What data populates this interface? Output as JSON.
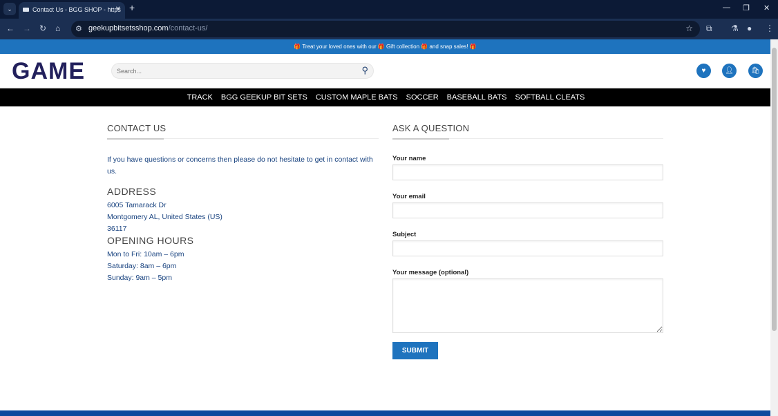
{
  "browser": {
    "tab_title": "Contact Us - BGG SHOP - https",
    "url_domain": "geekupbitsetsshop.com",
    "url_path": "/contact-us/"
  },
  "banner": {
    "text": "🎁 Treat your loved ones with our 🎁 Gift collection 🎁 and snap sales! 🎁"
  },
  "header": {
    "logo": "GAME",
    "search_placeholder": "Search..."
  },
  "nav": [
    "TRACK",
    "BGG GEEKUP BIT SETS",
    "CUSTOM MAPLE BATS",
    "SOCCER",
    "BASEBALL BATS",
    "SOFTBALL CLEATS"
  ],
  "contact": {
    "title": "CONTACT US",
    "intro": "If you have questions or concerns then please do not hesitate to get in contact with us.",
    "address_title": "ADDRESS",
    "address": [
      "6005 Tamarack Dr",
      "Montgomery AL, United States (US)",
      "36117"
    ],
    "hours_title": "OPENING HOURS",
    "hours": [
      "Mon to Fri: 10am – 6pm",
      "Saturday: 8am – 6pm",
      "Sunday: 9am – 5pm"
    ]
  },
  "form": {
    "title": "ASK A QUESTION",
    "name_label": "Your name",
    "email_label": "Your email",
    "subject_label": "Subject",
    "message_label": "Your message (optional)",
    "submit": "SUBMIT"
  }
}
